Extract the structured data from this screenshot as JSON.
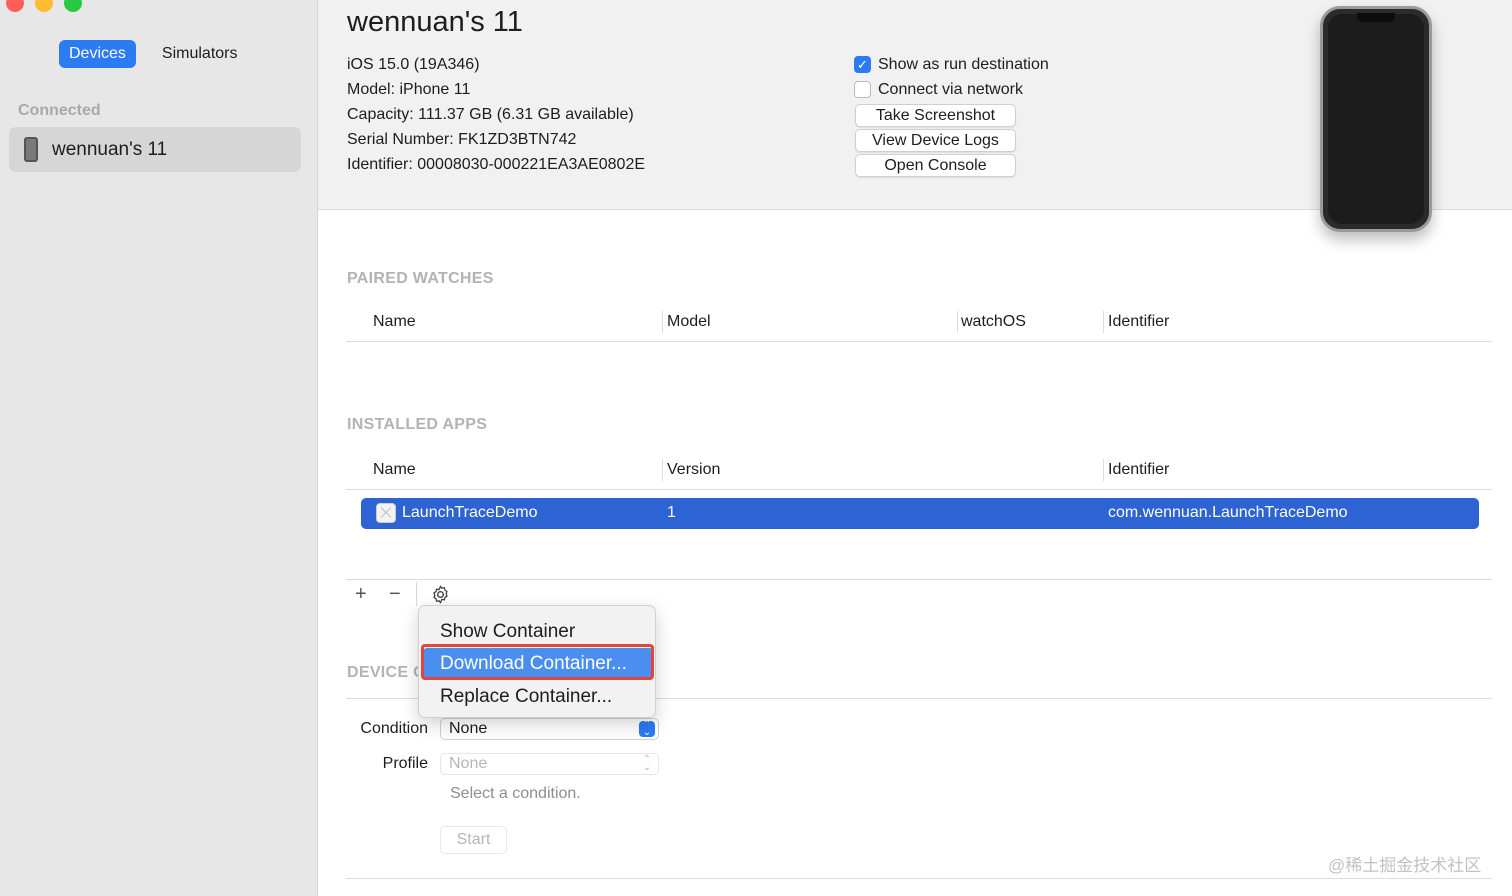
{
  "sidebar": {
    "tabs": [
      {
        "label": "Devices",
        "active": true
      },
      {
        "label": "Simulators",
        "active": false
      }
    ],
    "section_title": "Connected",
    "devices": [
      {
        "label": "wennuan's 11",
        "selected": true
      }
    ]
  },
  "device": {
    "title": "wennuan's 11",
    "info": [
      "iOS 15.0 (19A346)",
      "Model: iPhone 11",
      "Capacity: 111.37 GB (6.31 GB available)",
      "Serial Number: FK1ZD3BTN742",
      "Identifier: 00008030-000221EA3AE0802E"
    ],
    "checkboxes": [
      {
        "label": "Show as run destination",
        "checked": true
      },
      {
        "label": "Connect via network",
        "checked": false
      }
    ],
    "buttons": [
      "Take Screenshot",
      "View Device Logs",
      "Open Console"
    ]
  },
  "paired_watches": {
    "title": "PAIRED WATCHES",
    "columns": [
      "Name",
      "Model",
      "watchOS",
      "Identifier"
    ]
  },
  "installed_apps": {
    "title": "INSTALLED APPS",
    "columns": [
      "Name",
      "Version",
      "Identifier"
    ],
    "rows": [
      {
        "name": "LaunchTraceDemo",
        "version": "1",
        "identifier": "com.wennuan.LaunchTraceDemo",
        "selected": true
      }
    ],
    "toolbar": {
      "add": "+",
      "remove": "−",
      "gear_icon": "gear-icon"
    }
  },
  "context_menu": {
    "items": [
      {
        "label": "Show Container",
        "highlighted": false
      },
      {
        "label": "Download Container...",
        "highlighted": true
      },
      {
        "label": "Replace Container...",
        "highlighted": false
      }
    ]
  },
  "device_conditions": {
    "title": "DEVICE C",
    "condition_label": "Condition",
    "condition_value": "None",
    "profile_label": "Profile",
    "profile_value": "None",
    "hint": "Select a condition.",
    "start_label": "Start"
  },
  "watermark": "@稀土掘金技术社区",
  "colors": {
    "accent": "#2b7bf2",
    "selection": "#2d63d3",
    "menu_highlight": "#4a8ff0",
    "annotation_frame": "#e24638"
  }
}
